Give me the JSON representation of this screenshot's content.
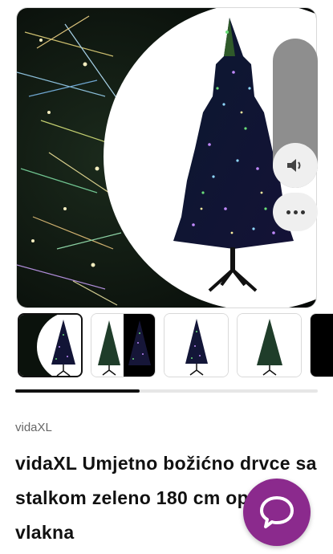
{
  "product": {
    "brand": "vidaXL",
    "title": "vidaXL Umjetno božićno drvce sa stalkom zeleno 180 cm optička vlakna"
  },
  "gallery": {
    "thumbnail_count": 5,
    "active_index": 0,
    "scroll_progress": 0.41
  },
  "controls": {
    "sound_icon": "speaker-icon",
    "more_icon": "more-dots-icon",
    "chat_icon": "chat-bubble-icon"
  },
  "colors": {
    "accent": "#8b2a8d",
    "panel": "#8e8e8e",
    "tree_dark": "#0d1030",
    "tree_green": "#1f3d2a"
  }
}
